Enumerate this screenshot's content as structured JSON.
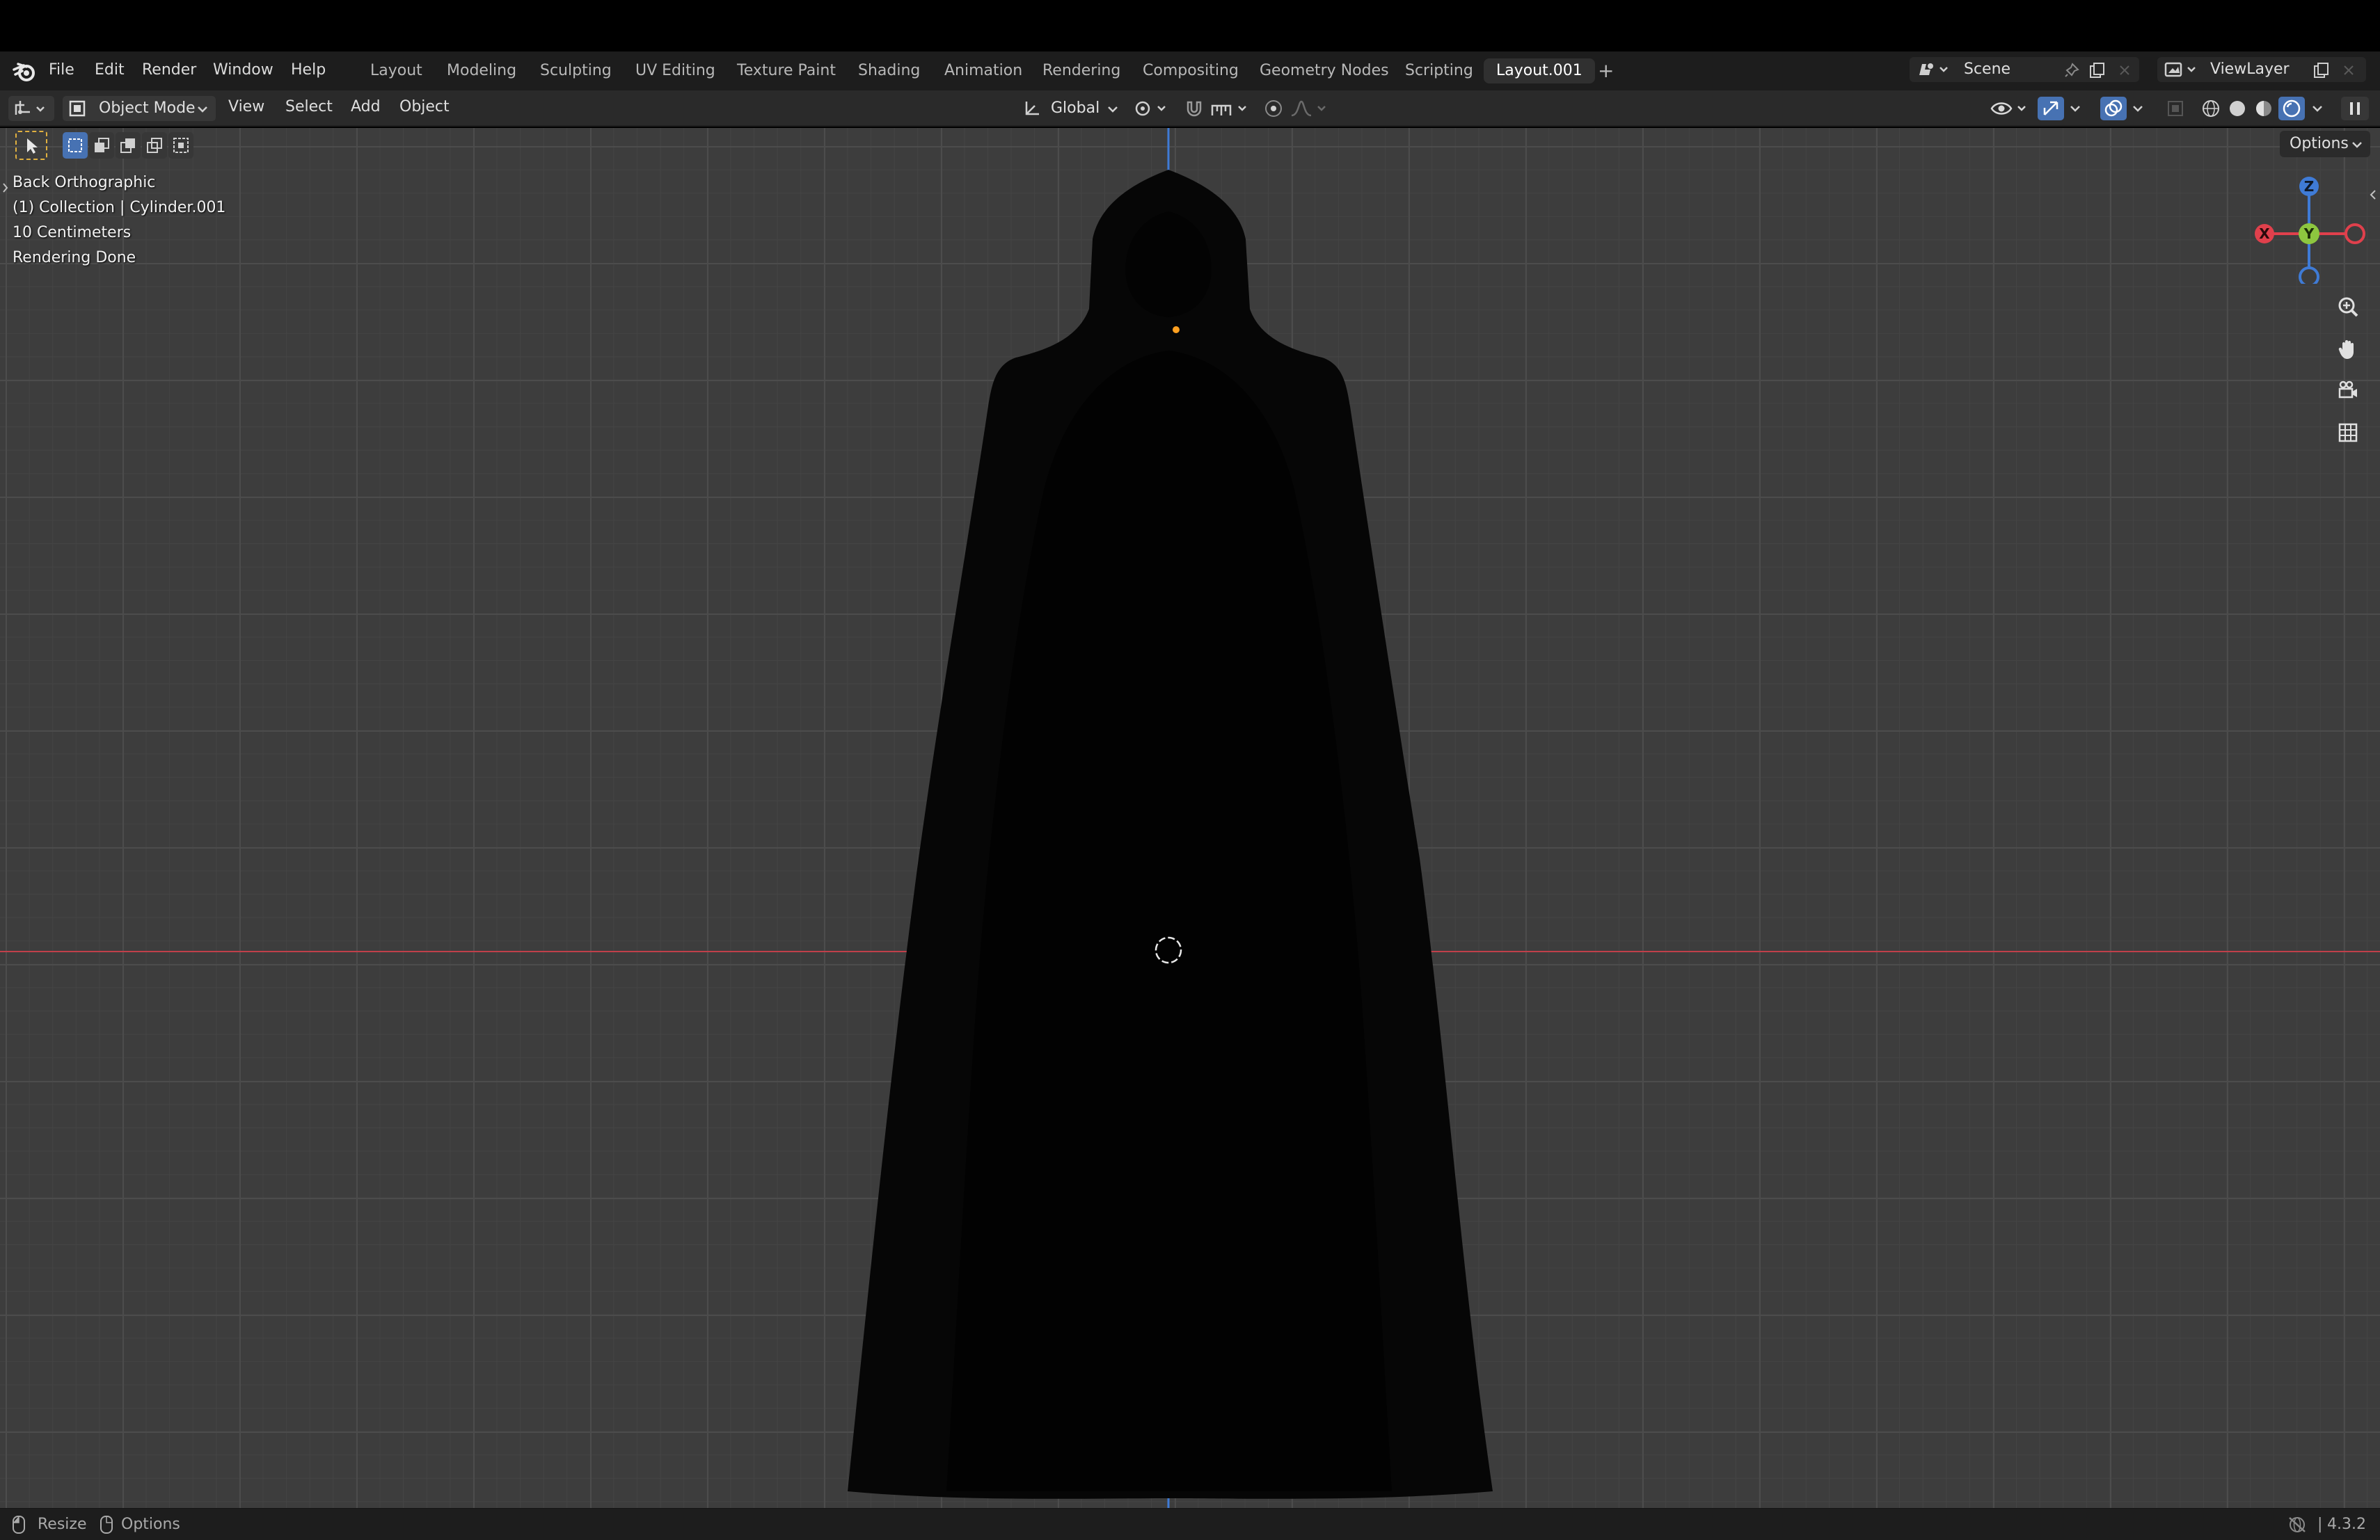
{
  "app": {
    "menu": [
      "File",
      "Edit",
      "Render",
      "Window",
      "Help"
    ],
    "workspaces": [
      {
        "label": "Layout"
      },
      {
        "label": "Modeling"
      },
      {
        "label": "Sculpting"
      },
      {
        "label": "UV Editing"
      },
      {
        "label": "Texture Paint"
      },
      {
        "label": "Shading"
      },
      {
        "label": "Animation"
      },
      {
        "label": "Rendering"
      },
      {
        "label": "Compositing"
      },
      {
        "label": "Geometry Nodes"
      },
      {
        "label": "Scripting"
      },
      {
        "label": "Layout.001",
        "active": true
      }
    ],
    "add_workspace": "+",
    "scene": "Scene",
    "view_layer": "ViewLayer"
  },
  "header": {
    "mode": "Object Mode",
    "menus": [
      "View",
      "Select",
      "Add",
      "Object"
    ],
    "orientation": "Global",
    "options_label": "Options"
  },
  "viewport": {
    "view_name": "Back Orthographic",
    "collection_line": "(1) Collection | Cylinder.001",
    "scale": "10 Centimeters",
    "status": "Rendering Done",
    "gizmo": {
      "z": "Z",
      "y": "Y",
      "x": "X"
    },
    "colors": {
      "background": "#3d3d3d",
      "x_axis": "#e0404c",
      "y_axis": "#8dc63f",
      "z_axis": "#3f7bd6",
      "origin": "#ffa020",
      "object": "#050505"
    }
  },
  "statusbar": {
    "resize": "Resize",
    "options": "Options",
    "version": "4.3.2"
  }
}
